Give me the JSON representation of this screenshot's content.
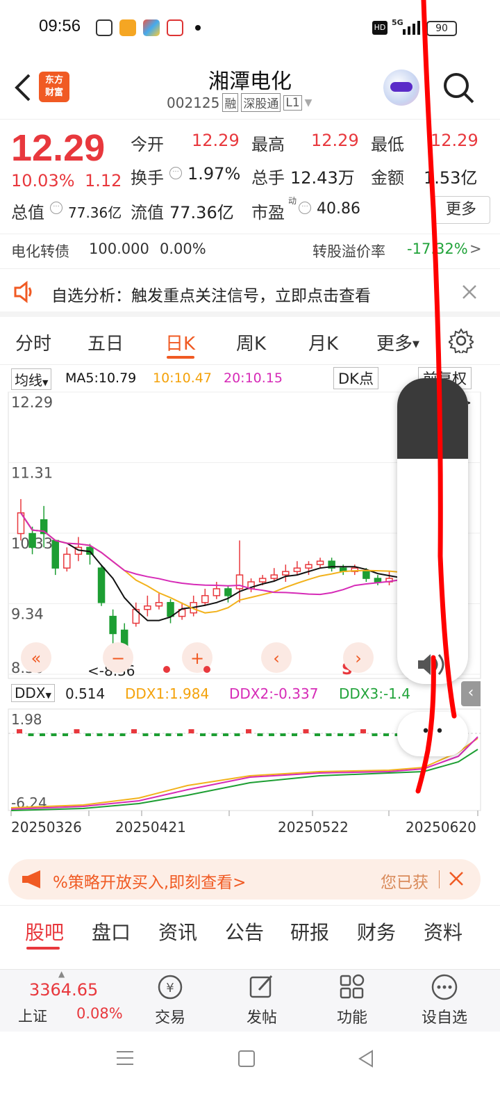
{
  "status_bar": {
    "time": "09:56",
    "battery": "90",
    "network": "5G"
  },
  "header": {
    "title": "湘潭电化",
    "code": "002125",
    "tags": [
      "融",
      "深股通",
      "L1"
    ],
    "brand": [
      "东方",
      "财富"
    ]
  },
  "quote": {
    "price": "12.29",
    "pct": "10.03%",
    "change": "1.12",
    "today_open_label": "今开",
    "today_open": "12.29",
    "high_label": "最高",
    "high": "12.29",
    "low_label": "最低",
    "low": "12.29",
    "turnover_label": "换手",
    "turnover": "1.97%",
    "volume_label": "总手",
    "volume": "12.43万",
    "amount_label": "金额",
    "amount": "1.53亿",
    "mktcap_label": "总值",
    "mktcap": "77.36亿",
    "float_label": "流值",
    "float": "77.36亿",
    "pe_label": "市盈",
    "pe_sup": "动",
    "pe": "40.86",
    "more": "更多"
  },
  "bond": {
    "name": "电化转债",
    "price": "100.000",
    "pct": "0.00%",
    "premium_label": "转股溢价率",
    "premium": "-17.32%"
  },
  "notice": {
    "text": "自选分析：触发重点关注信号，立即点击查看"
  },
  "tabs": [
    "分时",
    "五日",
    "日K",
    "周K",
    "月K",
    "更多"
  ],
  "active_tab": "日K",
  "ma_bar": {
    "selector": "均线",
    "ma5": "MA5:10.79",
    "ma10": "10:10.47",
    "ma20": "20:10.15",
    "dk": "DK点",
    "fq": "前复权"
  },
  "chart_data": {
    "type": "candlestick",
    "y_labels": [
      "12.29",
      "11.31",
      "10.33",
      "9.34",
      "8.36"
    ],
    "ylim": [
      8.36,
      12.29
    ],
    "min_marker": "<-8.36",
    "max_marker": "12.29->",
    "x_labels": [
      "20250326",
      "20250421",
      "20250522",
      "20250620"
    ],
    "candles": [
      [
        10.4,
        10.7,
        10.3,
        10.9
      ],
      [
        10.4,
        10.2,
        10.1,
        10.5
      ],
      [
        10.6,
        10.4,
        10.2,
        10.8
      ],
      [
        10.3,
        9.9,
        9.8,
        10.3
      ],
      [
        9.9,
        10.1,
        9.85,
        10.2
      ],
      [
        10.1,
        10.2,
        10.0,
        10.35
      ],
      [
        10.2,
        10.1,
        9.95,
        10.25
      ],
      [
        9.9,
        9.4,
        9.35,
        9.95
      ],
      [
        9.2,
        8.95,
        8.8,
        9.3
      ],
      [
        9.0,
        8.7,
        8.36,
        9.1
      ],
      [
        9.1,
        9.3,
        9.05,
        9.4
      ],
      [
        9.3,
        9.35,
        9.2,
        9.5
      ],
      [
        9.35,
        9.4,
        9.3,
        9.55
      ],
      [
        9.4,
        9.2,
        9.1,
        9.45
      ],
      [
        9.2,
        9.3,
        9.15,
        9.4
      ],
      [
        9.25,
        9.4,
        9.2,
        9.5
      ],
      [
        9.4,
        9.5,
        9.35,
        9.6
      ],
      [
        9.5,
        9.6,
        9.45,
        9.7
      ],
      [
        9.6,
        9.5,
        9.4,
        9.65
      ],
      [
        9.6,
        9.8,
        9.4,
        10.3
      ],
      [
        9.6,
        9.7,
        9.55,
        9.75
      ],
      [
        9.7,
        9.75,
        9.65,
        9.8
      ],
      [
        9.75,
        9.8,
        9.7,
        9.9
      ],
      [
        9.8,
        9.85,
        9.7,
        9.95
      ],
      [
        9.85,
        9.9,
        9.8,
        10.0
      ],
      [
        9.9,
        9.95,
        9.8,
        10.0
      ],
      [
        9.95,
        10.0,
        9.9,
        10.05
      ],
      [
        10.0,
        9.9,
        9.85,
        10.05
      ],
      [
        9.9,
        9.85,
        9.8,
        9.95
      ],
      [
        9.85,
        9.9,
        9.8,
        9.95
      ],
      [
        9.85,
        9.75,
        9.7,
        9.9
      ],
      [
        9.75,
        9.7,
        9.65,
        9.8
      ],
      [
        9.7,
        9.75,
        9.65,
        9.85
      ],
      [
        9.75,
        9.7,
        9.65,
        9.8
      ],
      [
        9.7,
        9.8,
        9.65,
        9.85
      ],
      [
        9.8,
        9.85,
        9.75,
        9.9
      ],
      [
        9.85,
        9.9,
        9.8,
        9.95
      ],
      [
        10.29,
        11.17,
        10.29,
        11.17
      ],
      [
        11.17,
        12.29,
        12.29,
        12.29
      ]
    ],
    "series": [
      {
        "name": "MA5",
        "color": "#111111"
      },
      {
        "name": "MA10",
        "color": "#f2b21c"
      },
      {
        "name": "MA20",
        "color": "#d62bb7"
      }
    ]
  },
  "chart_tools": [
    "«",
    "−",
    "+",
    "‹",
    "S",
    "›"
  ],
  "ddx": {
    "selector": "DDX",
    "value": "0.514",
    "ddx1": "DDX1:1.984",
    "ddx2": "DDX2:-0.337",
    "ddx3": "DDX3:-1.4",
    "ymax": "1.98",
    "ymin": "-6.24"
  },
  "promo": {
    "text": "%策略开放买入,即刻查看>",
    "right": "您已获"
  },
  "bottom_tabs": [
    "股吧",
    "盘口",
    "资讯",
    "公告",
    "研报",
    "财务",
    "资料"
  ],
  "nav": {
    "index_value": "3364.65",
    "index_name": "上证",
    "index_pct": "0.08%",
    "items": [
      "交易",
      "发帖",
      "功能",
      "设自选"
    ]
  }
}
